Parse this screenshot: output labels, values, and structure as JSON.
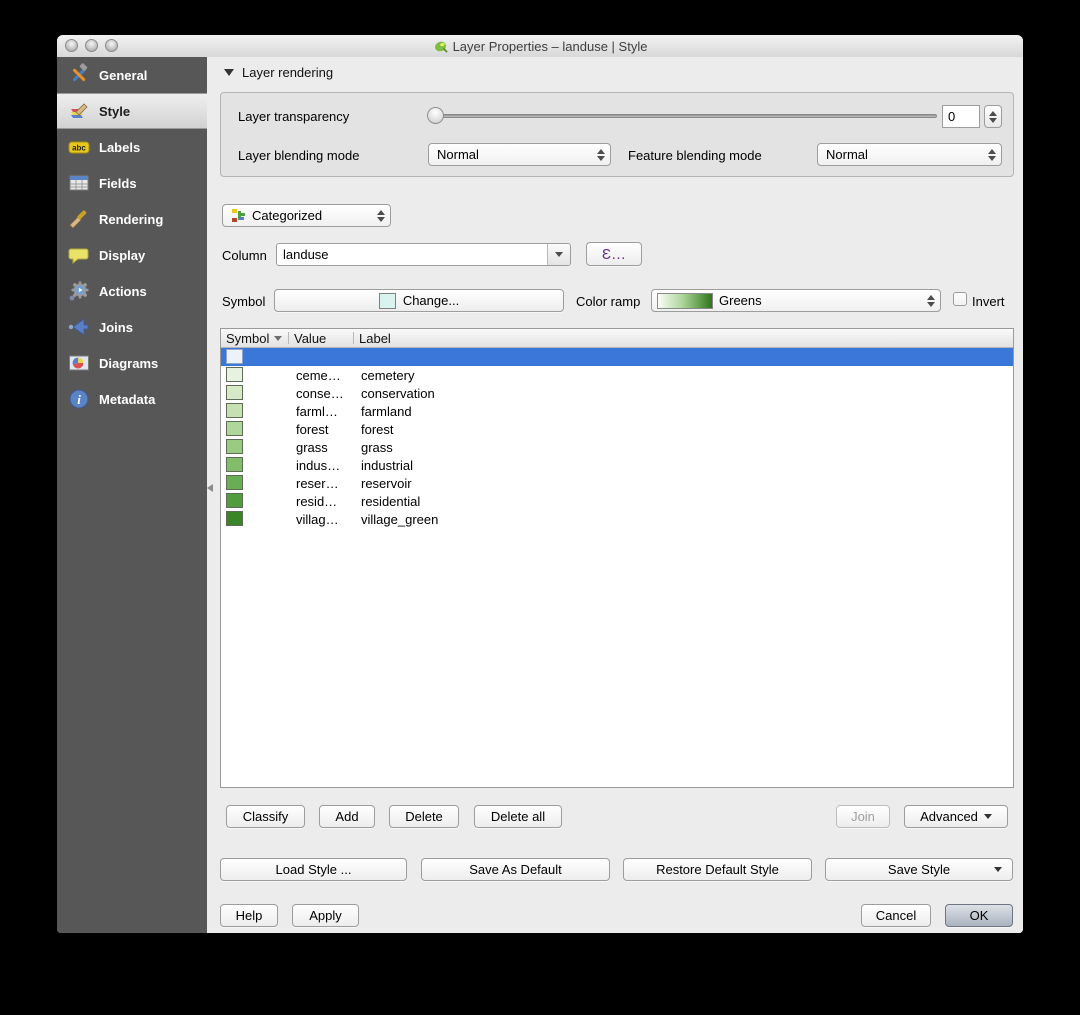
{
  "window": {
    "title": "Layer Properties – landuse | Style"
  },
  "sidebar": {
    "items": [
      {
        "label": "General",
        "icon": "tools-icon"
      },
      {
        "label": "Style",
        "icon": "paintbrush-layers-icon",
        "selected": true
      },
      {
        "label": "Labels",
        "icon": "abc-tag-icon"
      },
      {
        "label": "Fields",
        "icon": "table-icon"
      },
      {
        "label": "Rendering",
        "icon": "brush-icon"
      },
      {
        "label": "Display",
        "icon": "speech-bubble-icon"
      },
      {
        "label": "Actions",
        "icon": "gears-icon"
      },
      {
        "label": "Joins",
        "icon": "join-arrow-icon"
      },
      {
        "label": "Diagrams",
        "icon": "pie-chart-icon"
      },
      {
        "label": "Metadata",
        "icon": "info-icon"
      }
    ]
  },
  "rendering": {
    "section_title": "Layer rendering",
    "transparency_label": "Layer transparency",
    "transparency_value": "0",
    "layer_blending_label": "Layer blending mode",
    "layer_blending_value": "Normal",
    "feature_blending_label": "Feature blending mode",
    "feature_blending_value": "Normal"
  },
  "classification": {
    "renderer": "Categorized",
    "column_label": "Column",
    "column_value": "landuse",
    "expression_button": "Ɛ…",
    "symbol_label": "Symbol",
    "symbol_button": "Change...",
    "color_ramp_label": "Color ramp",
    "color_ramp_value": "Greens",
    "invert_label": "Invert"
  },
  "table": {
    "headers": [
      "Symbol",
      "Value",
      "Label"
    ],
    "rows": [
      {
        "swatch": "#edf1f8",
        "value": "",
        "label": "",
        "selected": true
      },
      {
        "swatch": "#e7f2e0",
        "value": "ceme…",
        "label": "cemetery"
      },
      {
        "swatch": "#d6eac8",
        "value": "conse…",
        "label": "conservation"
      },
      {
        "swatch": "#c5e1b2",
        "value": "farml…",
        "label": "farmland"
      },
      {
        "swatch": "#b0d79b",
        "value": "forest",
        "label": "forest"
      },
      {
        "swatch": "#9acb83",
        "value": "grass",
        "label": "grass"
      },
      {
        "swatch": "#81bd6a",
        "value": "indus…",
        "label": "industrial"
      },
      {
        "swatch": "#69ae53",
        "value": "reser…",
        "label": "reservoir"
      },
      {
        "swatch": "#519c3d",
        "value": "resid…",
        "label": "residential"
      },
      {
        "swatch": "#3a8627",
        "value": "villag…",
        "label": "village_green"
      }
    ]
  },
  "actions": {
    "classify": "Classify",
    "add": "Add",
    "delete": "Delete",
    "delete_all": "Delete all",
    "join": "Join",
    "advanced": "Advanced"
  },
  "style_buttons": {
    "load": "Load Style ...",
    "save_default": "Save As Default",
    "restore": "Restore Default Style",
    "save_style": "Save Style"
  },
  "footer": {
    "help": "Help",
    "apply": "Apply",
    "cancel": "Cancel",
    "ok": "OK"
  },
  "colors": {
    "selection": "#3b77d8",
    "sidebar_bg": "#575757",
    "ramp_start": "#f9fdf7",
    "ramp_end": "#2f7519",
    "expression_accent": "#6b2d84"
  }
}
